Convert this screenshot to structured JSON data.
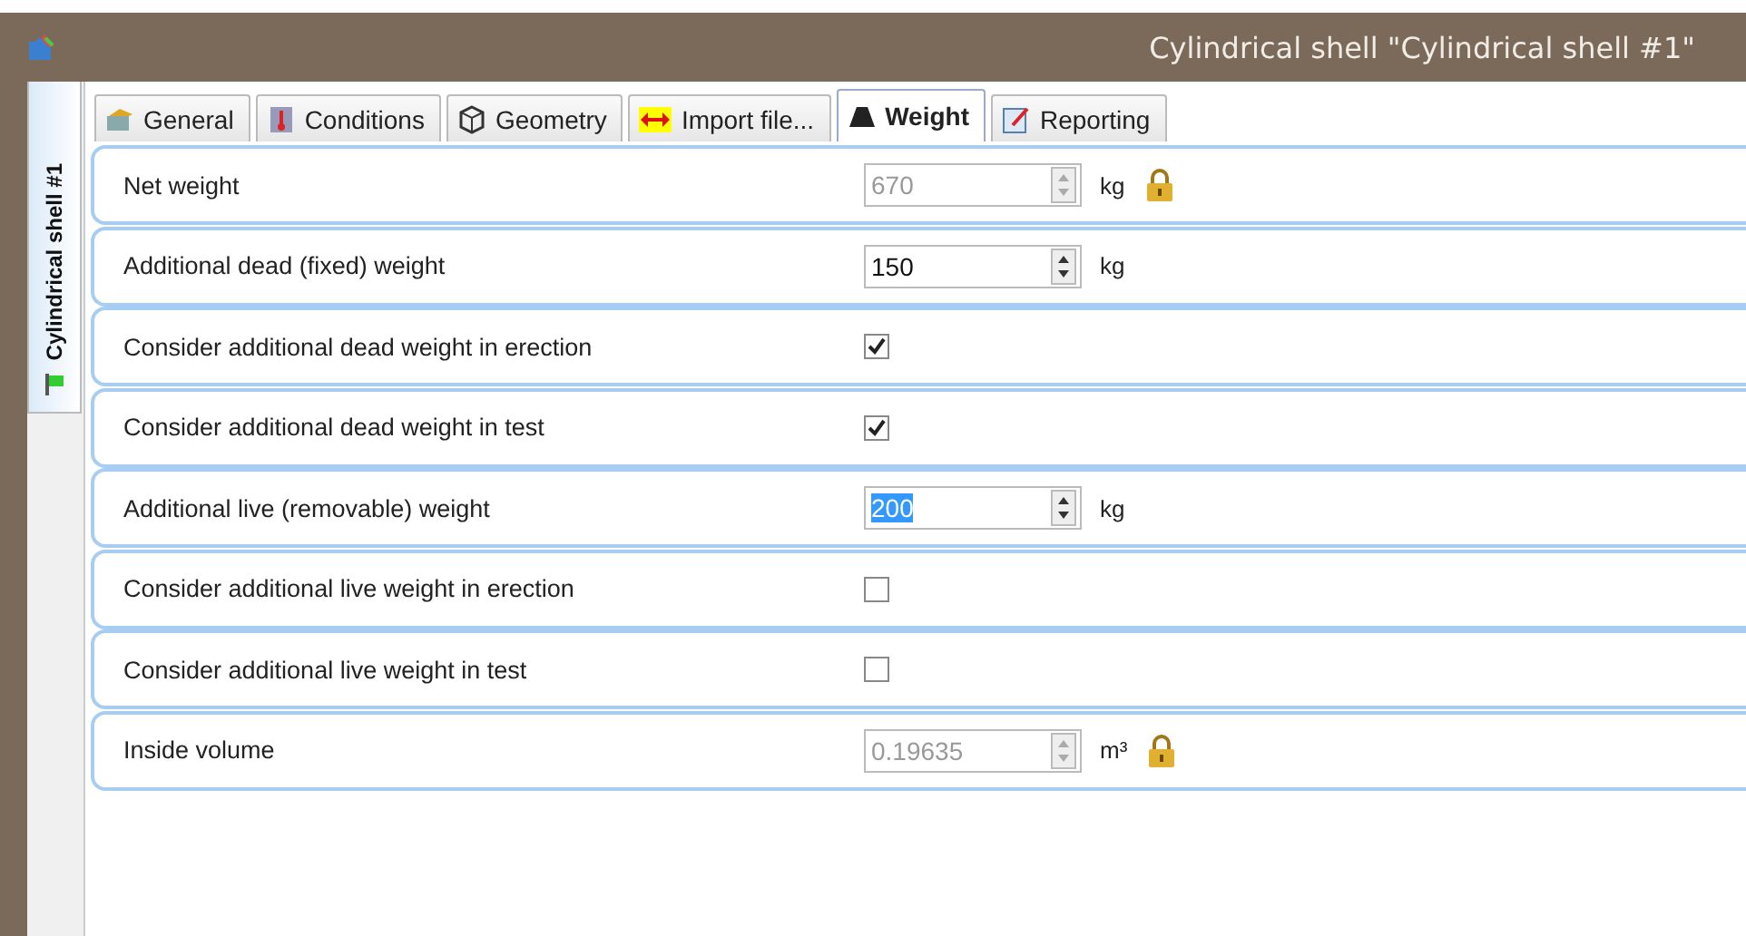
{
  "window": {
    "title": "Cylindrical shell \"Cylindrical shell #1\""
  },
  "side_tab": {
    "label": "Cylindrical shell #1",
    "selected": true
  },
  "tabs": [
    {
      "label": "General",
      "selected": false
    },
    {
      "label": "Conditions",
      "selected": false
    },
    {
      "label": "Geometry",
      "selected": false
    },
    {
      "label": "Import file...",
      "selected": false
    },
    {
      "label": "Weight",
      "selected": true
    },
    {
      "label": "Reporting",
      "selected": false
    }
  ],
  "rows": [
    {
      "kind": "number",
      "label": "Net weight",
      "value": "670",
      "unit": "kg",
      "disabled": true,
      "locked": true,
      "text_selected": false
    },
    {
      "kind": "number",
      "label": "Additional dead (fixed) weight",
      "value": "150",
      "unit": "kg",
      "disabled": false,
      "locked": false,
      "text_selected": false
    },
    {
      "kind": "checkbox",
      "label": "Consider additional dead weight in erection",
      "checked": true
    },
    {
      "kind": "checkbox",
      "label": "Consider additional dead weight in test",
      "checked": true
    },
    {
      "kind": "number",
      "label": "Additional live (removable) weight",
      "value": "200",
      "unit": "kg",
      "disabled": false,
      "locked": false,
      "text_selected": true
    },
    {
      "kind": "checkbox",
      "label": "Consider additional live weight in erection",
      "checked": false
    },
    {
      "kind": "checkbox",
      "label": "Consider additional live weight in test",
      "checked": false
    },
    {
      "kind": "number",
      "label": "Inside volume",
      "value": "0.19635",
      "unit": "m³",
      "disabled": true,
      "locked": true,
      "text_selected": false
    }
  ]
}
